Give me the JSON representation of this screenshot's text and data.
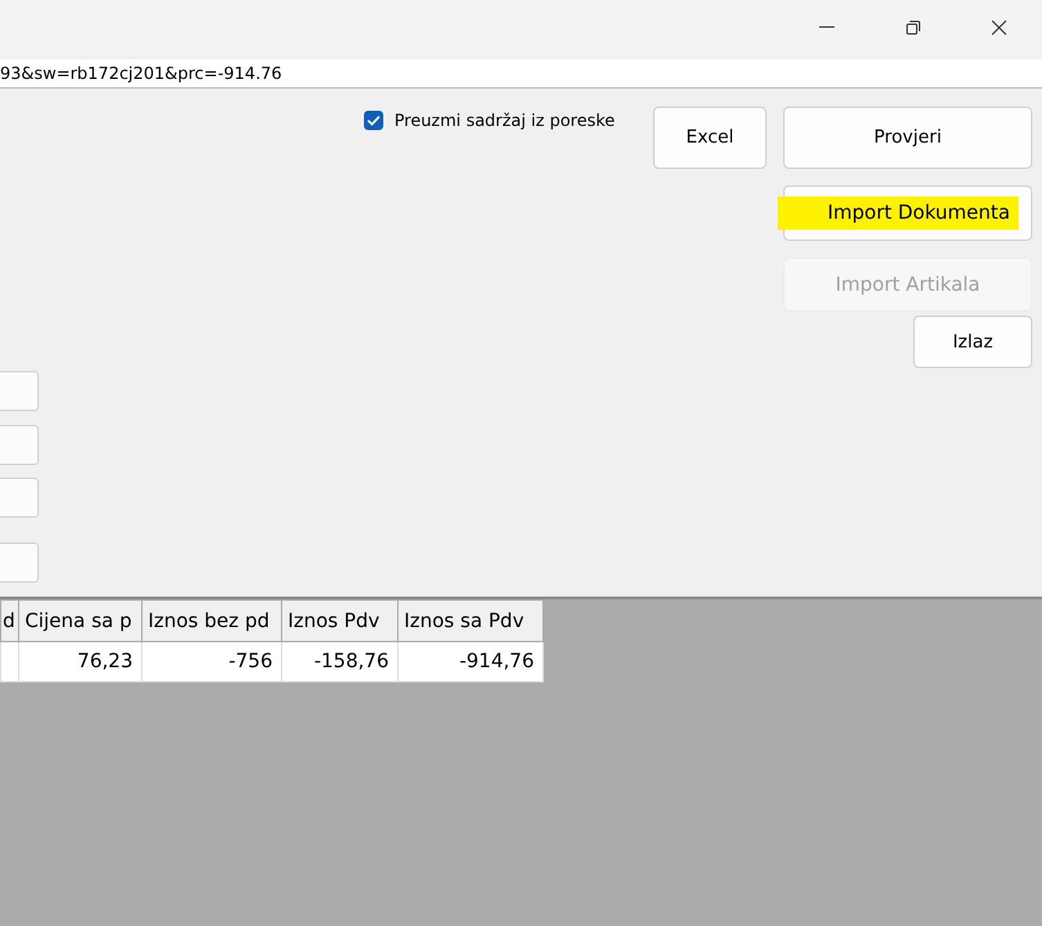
{
  "url_field": {
    "value": "93&sw=rb172cj201&prc=-914.76"
  },
  "checkbox": {
    "label": "Preuzmi sadržaj iz poreske",
    "checked": true
  },
  "buttons": [
    {
      "kind": "excel",
      "label": "Excel",
      "disabled": false
    },
    {
      "kind": "check",
      "label": "Provjeri",
      "disabled": false
    },
    {
      "kind": "import-doc",
      "label": "Import Dokumenta",
      "disabled": false,
      "highlighted": true
    },
    {
      "kind": "import-items",
      "label": "Import Artikala",
      "disabled": true
    },
    {
      "kind": "exit",
      "label": "Izlaz",
      "disabled": false
    }
  ],
  "table": {
    "columns": [
      "d",
      "Cijena sa p",
      "Iznos bez pd",
      "Iznos Pdv",
      "Iznos sa Pdv"
    ],
    "rows": [
      [
        "",
        "76,23",
        "-756",
        "-158,76",
        "-914,76"
      ]
    ]
  }
}
